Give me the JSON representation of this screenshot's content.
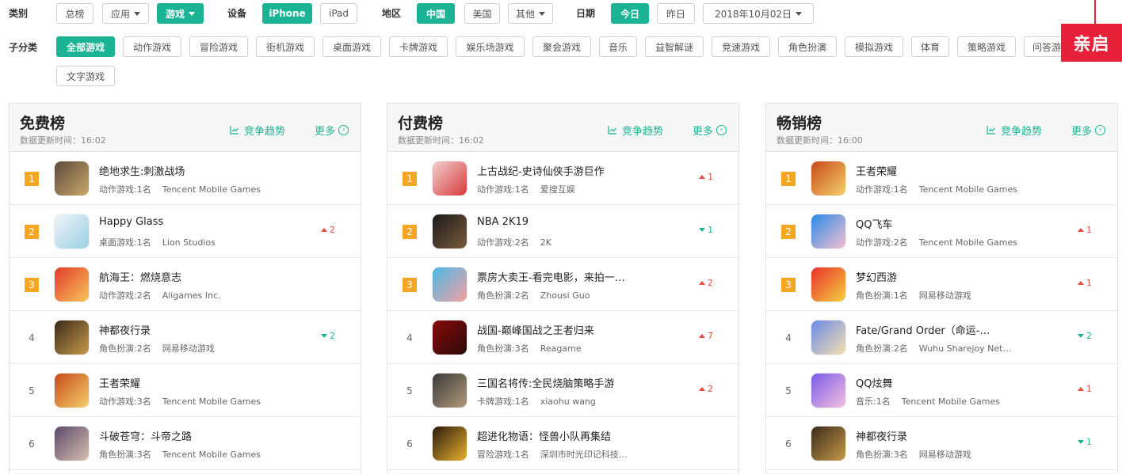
{
  "filters": {
    "category_label": "类别",
    "category": [
      "总榜",
      "应用",
      "游戏"
    ],
    "device_label": "设备",
    "device": [
      "iPhone",
      "iPad"
    ],
    "region_label": "地区",
    "region": [
      "中国",
      "美国",
      "其他"
    ],
    "date_label": "日期",
    "date": [
      "今日",
      "昨日",
      "2018年10月02日"
    ],
    "sub_label": "子分类",
    "sub": [
      "全部游戏",
      "动作游戏",
      "冒险游戏",
      "街机游戏",
      "桌面游戏",
      "卡牌游戏",
      "娱乐场游戏",
      "聚会游戏",
      "音乐",
      "益智解谜",
      "竞速游戏",
      "角色扮演",
      "模拟游戏",
      "体育",
      "策略游戏",
      "问答游",
      "文字游戏"
    ]
  },
  "promo": "亲启",
  "common": {
    "trend": "竞争趋势",
    "more": "更多"
  },
  "colors": {
    "accent": "#1ab394",
    "rank_badge": "#f5a623",
    "up": "#e74c3c",
    "down": "#1ab394",
    "promo": "#e8213a"
  },
  "panels": [
    {
      "title": "免费榜",
      "time": "数据更新时间：16:02",
      "rows": [
        {
          "rank": "1",
          "name": "绝地求生:刺激战场",
          "cat": "动作游戏:1名",
          "dev": "Tencent Mobile Games",
          "change": "",
          "dir": ""
        },
        {
          "rank": "2",
          "name": "Happy Glass",
          "cat": "桌面游戏:1名",
          "dev": "Lion Studios",
          "change": "2",
          "dir": "up"
        },
        {
          "rank": "3",
          "name": "航海王：燃烧意志",
          "cat": "动作游戏:2名",
          "dev": "Aligames Inc.",
          "change": "",
          "dir": ""
        },
        {
          "rank": "4",
          "name": "神都夜行录",
          "cat": "角色扮演:2名",
          "dev": "网易移动游戏",
          "change": "2",
          "dir": "down"
        },
        {
          "rank": "5",
          "name": "王者荣耀",
          "cat": "动作游戏:3名",
          "dev": "Tencent Mobile Games",
          "change": "",
          "dir": ""
        },
        {
          "rank": "6",
          "name": "斗破苍穹：斗帝之路",
          "cat": "角色扮演:3名",
          "dev": "Tencent Mobile Games",
          "change": "",
          "dir": ""
        }
      ]
    },
    {
      "title": "付费榜",
      "time": "数据更新时间：16:02",
      "rows": [
        {
          "rank": "1",
          "name": "上古战纪-史诗仙侠手游巨作",
          "cat": "动作游戏:1名",
          "dev": "爱搜互娱",
          "change": "1",
          "dir": "up"
        },
        {
          "rank": "2",
          "name": "NBA 2K19",
          "cat": "动作游戏:2名",
          "dev": "2K",
          "change": "1",
          "dir": "down"
        },
        {
          "rank": "3",
          "name": "票房大卖王-看完电影，来拍一…",
          "cat": "角色扮演:2名",
          "dev": "Zhousi Guo",
          "change": "2",
          "dir": "up"
        },
        {
          "rank": "4",
          "name": "战国-巅峰国战之王者归来",
          "cat": "角色扮演:3名",
          "dev": "Reagame",
          "change": "7",
          "dir": "up"
        },
        {
          "rank": "5",
          "name": "三国名将传:全民烧脑策略手游",
          "cat": "卡牌游戏:1名",
          "dev": "xiaohu wang",
          "change": "2",
          "dir": "up"
        },
        {
          "rank": "6",
          "name": "超进化物语：怪兽小队再集结",
          "cat": "冒险游戏:1名",
          "dev": "深圳市时光印记科技…",
          "change": "",
          "dir": ""
        }
      ]
    },
    {
      "title": "畅销榜",
      "time": "数据更新时间：16:00",
      "rows": [
        {
          "rank": "1",
          "name": "王者荣耀",
          "cat": "动作游戏:1名",
          "dev": "Tencent Mobile Games",
          "change": "",
          "dir": ""
        },
        {
          "rank": "2",
          "name": "QQ飞车",
          "cat": "动作游戏:2名",
          "dev": "Tencent Mobile Games",
          "change": "1",
          "dir": "up"
        },
        {
          "rank": "3",
          "name": "梦幻西游",
          "cat": "角色扮演:1名",
          "dev": "网易移动游戏",
          "change": "1",
          "dir": "up"
        },
        {
          "rank": "4",
          "name": "Fate/Grand Order（命运-…",
          "cat": "角色扮演:2名",
          "dev": "Wuhu Sharejoy Net…",
          "change": "2",
          "dir": "down"
        },
        {
          "rank": "5",
          "name": "QQ炫舞",
          "cat": "音乐:1名",
          "dev": "Tencent Mobile Games",
          "change": "1",
          "dir": "up"
        },
        {
          "rank": "6",
          "name": "神都夜行录",
          "cat": "角色扮演:3名",
          "dev": "网易移动游戏",
          "change": "1",
          "dir": "down"
        }
      ]
    }
  ]
}
